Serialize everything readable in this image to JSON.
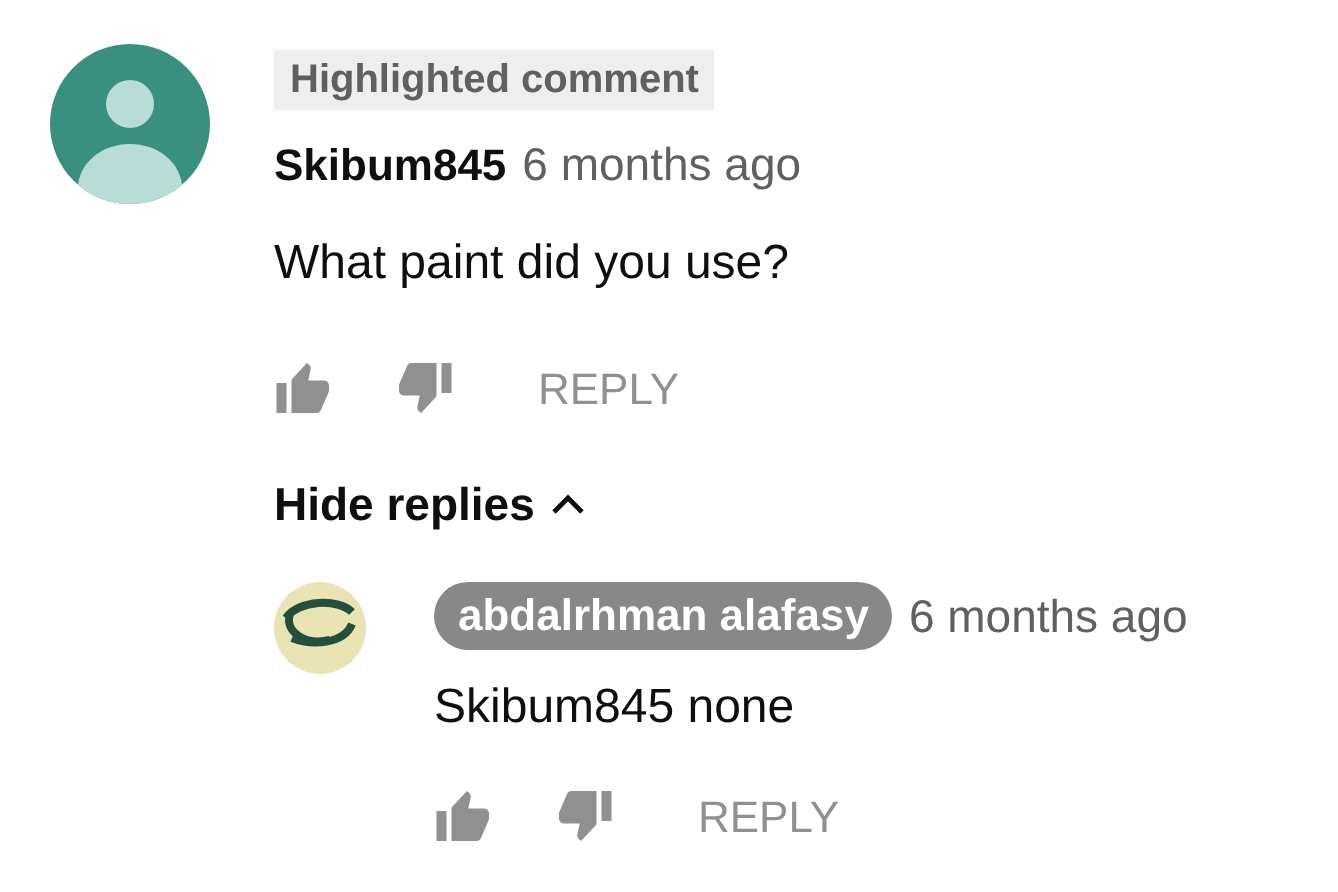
{
  "comment": {
    "badge": "Highlighted comment",
    "author": "Skibum845",
    "time": "6 months ago",
    "text": "What paint did you use?",
    "reply_label": "REPLY"
  },
  "replies_toggle": {
    "label": "Hide replies",
    "expanded": true
  },
  "replies": [
    {
      "author": "abdalrhman alafasy",
      "author_highlighted": true,
      "time": "6 months ago",
      "text": "Skibum845 none",
      "reply_label": "REPLY"
    }
  ]
}
